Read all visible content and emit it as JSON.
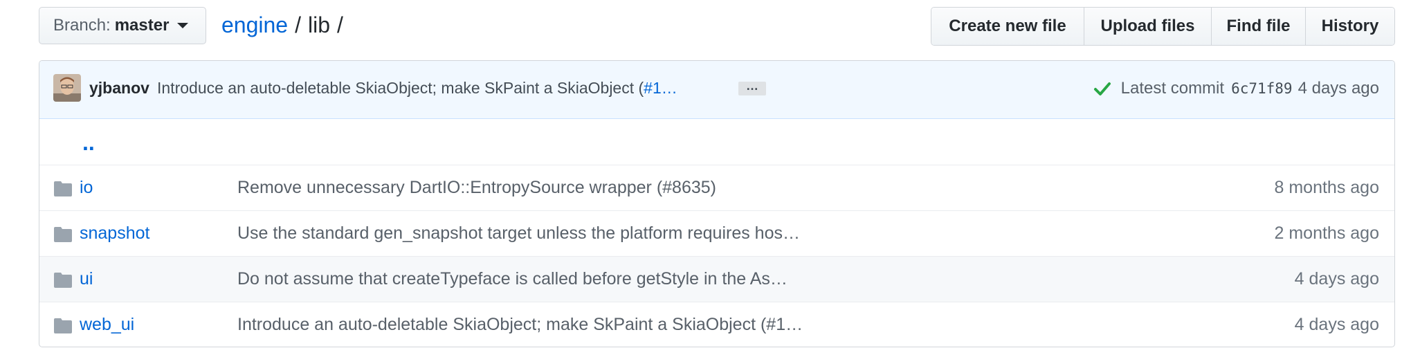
{
  "branch": {
    "label": "Branch:",
    "name": "master"
  },
  "breadcrumb": {
    "root": "engine",
    "separator": "/",
    "current": "lib",
    "trailing": "/"
  },
  "actions": [
    "Create new file",
    "Upload files",
    "Find file",
    "History"
  ],
  "commit": {
    "author": "yjbanov",
    "message": "Introduce an auto-deletable SkiaObject; make SkPaint a SkiaObject (",
    "pr_link": "#1…",
    "ellipsis": "…",
    "latest_label": "Latest commit",
    "sha": "6c71f89",
    "age": "4 days ago"
  },
  "files": {
    "parent": "..",
    "rows": [
      {
        "name": "io",
        "message": "Remove unnecessary DartIO::EntropySource wrapper (#8635)",
        "age": "8 months ago"
      },
      {
        "name": "snapshot",
        "message": "Use the standard gen_snapshot target unless the platform requires hos…",
        "age": "2 months ago"
      },
      {
        "name": "ui",
        "message": "Do not assume that createTypeface is called before getStyle in the As…",
        "age": "4 days ago"
      },
      {
        "name": "web_ui",
        "message": "Introduce an auto-deletable SkiaObject; make SkPaint a SkiaObject (#1…",
        "age": "4 days ago"
      }
    ]
  },
  "icons": {
    "folder": "folder-icon",
    "check": "check-icon",
    "caret": "caret-down-icon"
  },
  "colors": {
    "link": "#0366d6",
    "tease_bg": "#f1f8ff",
    "check": "#28a745",
    "alt_row": "#f6f8fa"
  }
}
